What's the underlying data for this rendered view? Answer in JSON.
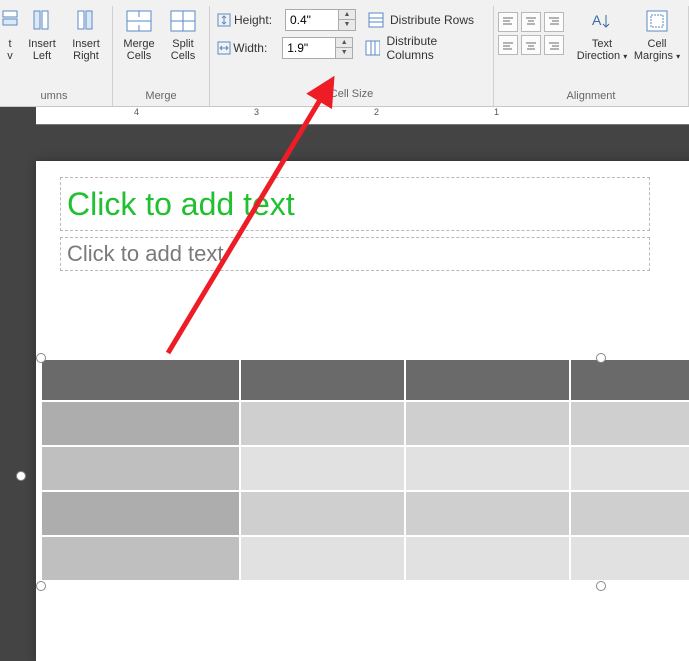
{
  "ribbon": {
    "groups": {
      "rowscols": {
        "label": "umns",
        "insert_row_v": "t\nv",
        "insert_left": "Insert\nLeft",
        "insert_right": "Insert\nRight"
      },
      "merge": {
        "label": "Merge",
        "merge_cells": "Merge\nCells",
        "split_cells": "Split\nCells"
      },
      "cellsize": {
        "label": "Cell Size",
        "height_label": "Height:",
        "width_label": "Width:",
        "height_value": "0.4\"",
        "width_value": "1.9\"",
        "distribute_rows": "Distribute Rows",
        "distribute_columns": "Distribute Columns"
      },
      "alignment": {
        "label": "Alignment",
        "text_direction": "Text\nDirection",
        "cell_margins": "Cell\nMargins"
      }
    }
  },
  "slide": {
    "title_placeholder": "Click to add text",
    "sub_placeholder": "Click to add text"
  },
  "ruler": {
    "marks": [
      "4",
      "3",
      "2",
      "1"
    ]
  }
}
